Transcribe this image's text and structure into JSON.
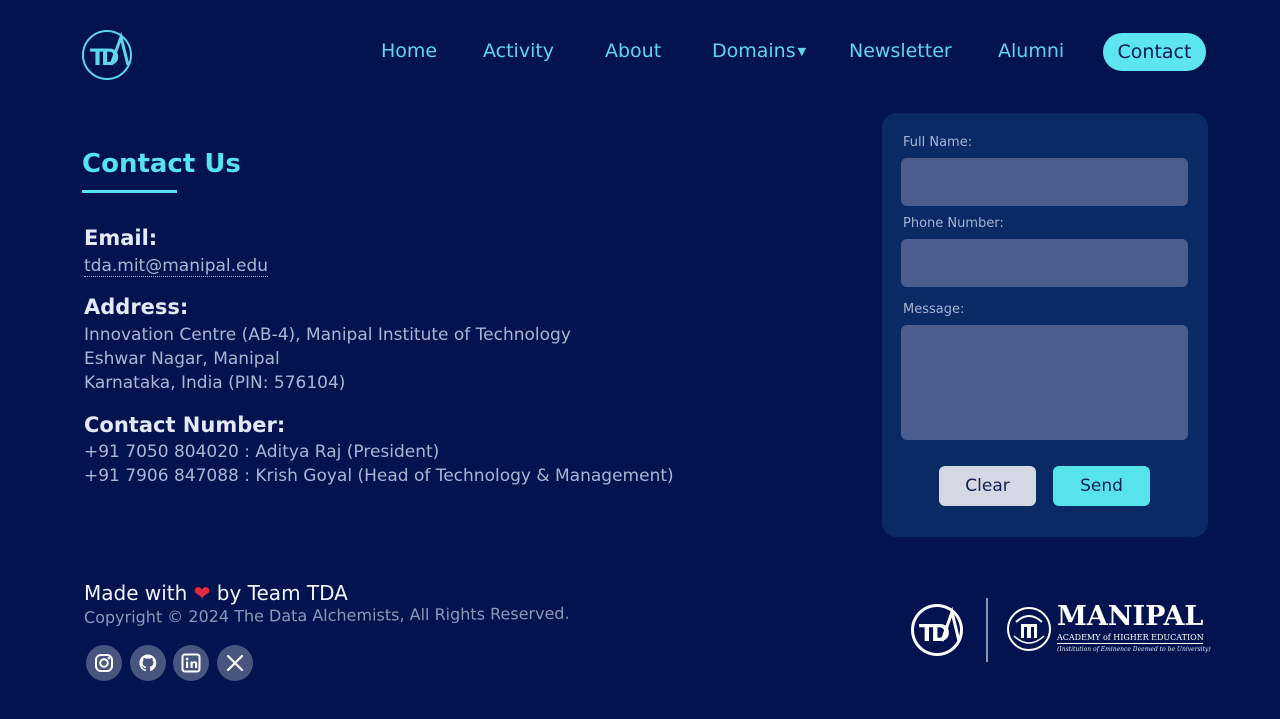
{
  "header": {
    "logo_text": "TDA",
    "nav": [
      {
        "label": "Home"
      },
      {
        "label": "Activity"
      },
      {
        "label": "About"
      },
      {
        "label": "Domains",
        "has_dropdown": true
      },
      {
        "label": "Newsletter"
      },
      {
        "label": "Alumni"
      }
    ],
    "contact_label": "Contact"
  },
  "contact": {
    "title": "Contact Us",
    "email_label": "Email:",
    "email": "tda.mit@manipal.edu",
    "address_label": "Address:",
    "address_lines": [
      "Innovation Centre (AB-4), Manipal Institute of Technology",
      "Eshwar Nagar, Manipal",
      "Karnataka, India (PIN: 576104)"
    ],
    "number_label": "Contact Number:",
    "numbers": [
      "+91 7050 804020 : Aditya Raj (President)",
      "+91 7906 847088 : Krish Goyal (Head of Technology & Management)"
    ]
  },
  "form": {
    "full_name_label": "Full Name:",
    "full_name_value": "",
    "phone_label": "Phone Number:",
    "phone_value": "",
    "message_label": "Message:",
    "message_value": "",
    "clear_label": "Clear",
    "send_label": "Send"
  },
  "footer": {
    "made_with_prefix": "Made with",
    "made_with_suffix": "by Team TDA",
    "copyright": "Copyright © 2024 The Data Alchemists, All Rights Reserved.",
    "socials": [
      "instagram-icon",
      "github-icon",
      "linkedin-icon",
      "x-icon"
    ],
    "logo_text": "TDA",
    "manipal_name": "MANIPAL",
    "manipal_sub": "ACADEMY of HIGHER EDUCATION",
    "manipal_tagline": "(Institution of Eminence Deemed to be University)",
    "manipal_seal_text": "INSPIRED BY LIFE"
  },
  "colors": {
    "background": "#02134f",
    "accent": "#57e2ef",
    "card": "#0a2a66",
    "input": "#4a5d8c"
  }
}
